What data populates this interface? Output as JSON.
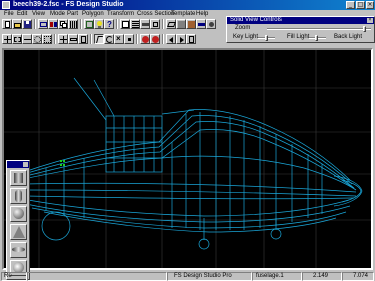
{
  "window": {
    "title": "beech39-2.fsc - FS Design Studio"
  },
  "menu": [
    "File",
    "Edit",
    "View",
    "Mode",
    "Part",
    "Polygon",
    "Transform",
    "Cross Section",
    "Template",
    "Help"
  ],
  "solid_view_controls": {
    "title": "Solid View Controls",
    "zoom_label": "Zoom",
    "key_light_label": "Key Light",
    "fill_light_label": "Fill Light",
    "back_light_label": "Back Light"
  },
  "status": {
    "left": "Re",
    "app": "FS Design Studio Pro",
    "part": "fuselage.1",
    "x": "2.149",
    "y": "7.074"
  },
  "colors": {
    "wireframe": "#1aa6d8",
    "selection": "#22cc22",
    "background": "#000000"
  }
}
